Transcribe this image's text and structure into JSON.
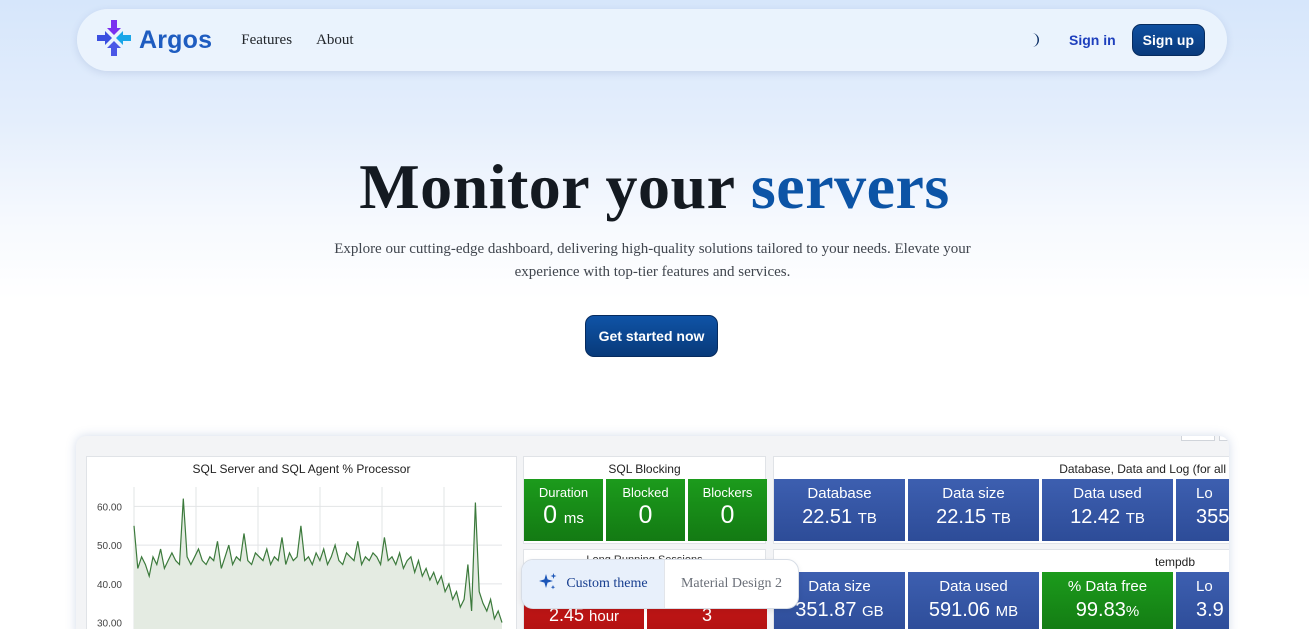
{
  "nav": {
    "brand": "Argos",
    "links": [
      "Features",
      "About"
    ],
    "signin": "Sign in",
    "signup": "Sign up",
    "theme_toggle_icon": "moon-icon"
  },
  "hero": {
    "title_prefix": "Monitor your ",
    "title_accent": "servers",
    "subtitle": "Explore our cutting-edge dashboard, delivering high-quality solutions tailored to your needs. Elevate your experience with top-tier features and services.",
    "cta": "Get started now"
  },
  "dashboard": {
    "cpu_title": "SQL Server and SQL Agent % Processor",
    "y_ticks": [
      "60.00",
      "50.00",
      "40.00",
      "30.00"
    ],
    "blocking_title": "SQL Blocking",
    "blocking_tiles": [
      {
        "label": "Duration",
        "value": "0",
        "unit": "ms"
      },
      {
        "label": "Blocked",
        "value": "0",
        "unit": ""
      },
      {
        "label": "Blockers",
        "value": "0",
        "unit": ""
      }
    ],
    "db_title": "Database, Data and Log (for all",
    "db_tiles": [
      {
        "label": "Database",
        "value": "22.51",
        "unit": "TB"
      },
      {
        "label": "Data size",
        "value": "22.15",
        "unit": "TB"
      },
      {
        "label": "Data used",
        "value": "12.42",
        "unit": "TB"
      },
      {
        "label": "Lo",
        "value": "355",
        "unit": ""
      }
    ],
    "long_title": "Long Running Sessions",
    "long_tiles": [
      {
        "value": "2.45",
        "unit": "hour"
      },
      {
        "value": "3",
        "unit": ""
      }
    ],
    "temp_title": "tempdb",
    "temp_tiles": [
      {
        "label": "Data size",
        "value": "351.87",
        "unit": "GB"
      },
      {
        "label": "Data used",
        "value": "591.06",
        "unit": "MB"
      },
      {
        "label": "% Data free",
        "value": "99.83",
        "unit": "%"
      },
      {
        "label": "Lo",
        "value": "3.9",
        "unit": ""
      }
    ],
    "colors": {
      "green": "#1c9b1c",
      "blue": "#3d5fb0",
      "red": "#d21c1c",
      "line": "#3c7a3c"
    }
  },
  "theme_switch": {
    "custom": "Custom theme",
    "material": "Material Design 2",
    "custom_icon": "sparkles-icon"
  },
  "chart_data": {
    "type": "line",
    "title": "SQL Server and SQL Agent % Processor",
    "ylim": [
      25,
      65
    ],
    "y_ticks": [
      60,
      50,
      40,
      30
    ],
    "series": [
      {
        "values": [
          55,
          44,
          47,
          45,
          42,
          47,
          45,
          49,
          44,
          46,
          48,
          46,
          45,
          62,
          47,
          45,
          47,
          49,
          46,
          45,
          47,
          46,
          51,
          44,
          47,
          50,
          45,
          47,
          46,
          53,
          46,
          45,
          48,
          47,
          46,
          49,
          45,
          47,
          46,
          52,
          45,
          48,
          46,
          47,
          55,
          46,
          47,
          45,
          48,
          46,
          49,
          45,
          47,
          50,
          46,
          45,
          48,
          47,
          46,
          51,
          45,
          47,
          46,
          48,
          47,
          45,
          52,
          46,
          47,
          45,
          48,
          44,
          46,
          47,
          43,
          46,
          42,
          44,
          41,
          43,
          40,
          42,
          38,
          40,
          36,
          38,
          34,
          36,
          45,
          33,
          61,
          38,
          35,
          33,
          36,
          31,
          33,
          30
        ]
      }
    ]
  }
}
